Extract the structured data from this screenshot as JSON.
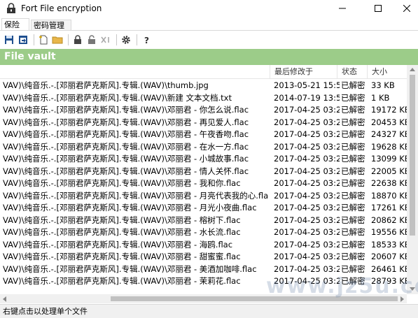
{
  "window": {
    "title": "Fort File encryption"
  },
  "tabs": [
    {
      "label": "保险库"
    },
    {
      "label": "密码管理器"
    }
  ],
  "vault": {
    "header": "File vault"
  },
  "columns": {
    "date": "最后修改于",
    "status": "状态",
    "size": "大小"
  },
  "files": [
    {
      "name": "VAV)\\纯音乐.-.[邓丽君萨克斯风].专辑.(WAV)\\thumb.jpg",
      "date": "2013-05-21 15:52",
      "status": "已解密",
      "size": "33 KB"
    },
    {
      "name": "VAV)\\纯音乐.-.[邓丽君萨克斯风].专辑.(WAV)\\新建 文本文档.txt",
      "date": "2014-07-19 13:56",
      "status": "已解密",
      "size": "1 KB"
    },
    {
      "name": "VAV)\\纯音乐.-.[邓丽君萨克斯风].专辑.(WAV)\\邓丽君 - 你怎么说.flac",
      "date": "2017-04-25 03:22",
      "status": "已解密",
      "size": "19172 KB"
    },
    {
      "name": "VAV)\\纯音乐.-.[邓丽君萨克斯风].专辑.(WAV)\\邓丽君 - 再见爱人.flac",
      "date": "2017-04-25 03:21",
      "status": "已解密",
      "size": "20453 KB"
    },
    {
      "name": "VAV)\\纯音乐.-.[邓丽君萨克斯风].专辑.(WAV)\\邓丽君 - 午夜香吻.flac",
      "date": "2017-04-25 03:20",
      "status": "已解密",
      "size": "24327 KB"
    },
    {
      "name": "VAV)\\纯音乐.-.[邓丽君萨克斯风].专辑.(WAV)\\邓丽君 - 在水一方.flac",
      "date": "2017-04-25 03:22",
      "status": "已解密",
      "size": "19628 KB"
    },
    {
      "name": "VAV)\\纯音乐.-.[邓丽君萨克斯风].专辑.(WAV)\\邓丽君 - 小城故事.flac",
      "date": "2017-04-25 03:24",
      "status": "已解密",
      "size": "13099 KB"
    },
    {
      "name": "VAV)\\纯音乐.-.[邓丽君萨克斯风].专辑.(WAV)\\邓丽君 - 情人关怀.flac",
      "date": "2017-04-25 03:22",
      "status": "已解密",
      "size": "22005 KB"
    },
    {
      "name": "VAV)\\纯音乐.-.[邓丽君萨克斯风].专辑.(WAV)\\邓丽君 - 我和你.flac",
      "date": "2017-04-25 03:23",
      "status": "已解密",
      "size": "22638 KB"
    },
    {
      "name": "VAV)\\纯音乐.-.[邓丽君萨克斯风].专辑.(WAV)\\邓丽君 - 月亮代表我的心.flac",
      "date": "2017-04-25 03:22",
      "status": "已解密",
      "size": "18870 KB"
    },
    {
      "name": "VAV)\\纯音乐.-.[邓丽君萨克斯风].专辑.(WAV)\\邓丽君 - 月光小夜曲.flac",
      "date": "2017-04-25 03:25",
      "status": "已解密",
      "size": "17261 KB"
    },
    {
      "name": "VAV)\\纯音乐.-.[邓丽君萨克斯风].专辑.(WAV)\\邓丽君 - 榕树下.flac",
      "date": "2017-04-25 03:23",
      "status": "已解密",
      "size": "20862 KB"
    },
    {
      "name": "VAV)\\纯音乐.-.[邓丽君萨克斯风].专辑.(WAV)\\邓丽君 - 水长流.flac",
      "date": "2017-04-25 03:24",
      "status": "已解密",
      "size": "19556 KB"
    },
    {
      "name": "VAV)\\纯音乐.-.[邓丽君萨克斯风].专辑.(WAV)\\邓丽君 - 海鸥.flac",
      "date": "2017-04-25 03:24",
      "status": "已解密",
      "size": "18533 KB"
    },
    {
      "name": "VAV)\\纯音乐.-.[邓丽君萨克斯风].专辑.(WAV)\\邓丽君 - 甜蜜蜜.flac",
      "date": "2017-04-25 03:26",
      "status": "已解密",
      "size": "20607 KB"
    },
    {
      "name": "VAV)\\纯音乐.-.[邓丽君萨克斯风].专辑.(WAV)\\邓丽君 - 美酒加咖啡.flac",
      "date": "2017-04-25 03:25",
      "status": "已解密",
      "size": "26461 KB"
    },
    {
      "name": "VAV)\\纯音乐.-.[邓丽君萨克斯风].专辑.(WAV)\\邓丽君 - 茉莉花.flac",
      "date": "2017-04-25 03:26",
      "status": "已解密",
      "size": "28793 KB"
    }
  ],
  "statusbar": {
    "text": "右键点击以处理单个文件"
  },
  "watermark": {
    "text": "www.jz5u.com"
  },
  "toolbar": {
    "icons": [
      "save-icon",
      "open-icon",
      "new-file-icon",
      "folder-icon",
      "lock-icon",
      "unlock-icon",
      "delete-icon",
      "settings-icon",
      "help-icon"
    ]
  }
}
